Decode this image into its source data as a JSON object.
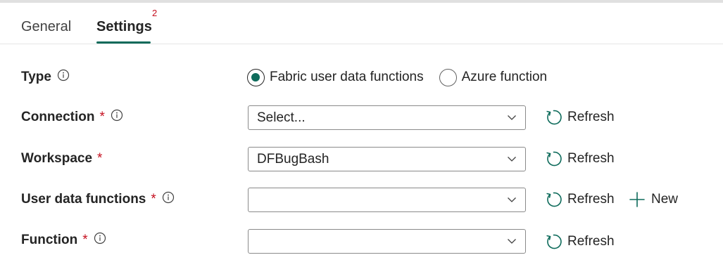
{
  "tabs": [
    {
      "label": "General",
      "selected": false
    },
    {
      "label": "Settings",
      "selected": true,
      "badge": "2"
    }
  ],
  "form": {
    "type": {
      "label": "Type",
      "options": [
        {
          "label": "Fabric user data functions",
          "selected": true
        },
        {
          "label": "Azure function",
          "selected": false
        }
      ]
    },
    "connection": {
      "label": "Connection",
      "required": "*",
      "value": "Select...",
      "refresh_label": "Refresh"
    },
    "workspace": {
      "label": "Workspace",
      "required": "*",
      "value": "DFBugBash",
      "refresh_label": "Refresh"
    },
    "user_data_functions": {
      "label": "User data functions",
      "required": "*",
      "value": "",
      "refresh_label": "Refresh",
      "new_label": "New"
    },
    "function": {
      "label": "Function",
      "required": "*",
      "value": "",
      "refresh_label": "Refresh"
    }
  },
  "colors": {
    "accent": "#0e6b5b",
    "required": "#c50f1f",
    "text": "#242424",
    "border": "#8a8a8a"
  },
  "icons": {
    "info": "info-icon",
    "refresh": "refresh-icon",
    "chevron": "chevron-down-icon",
    "new": "plus-icon"
  }
}
